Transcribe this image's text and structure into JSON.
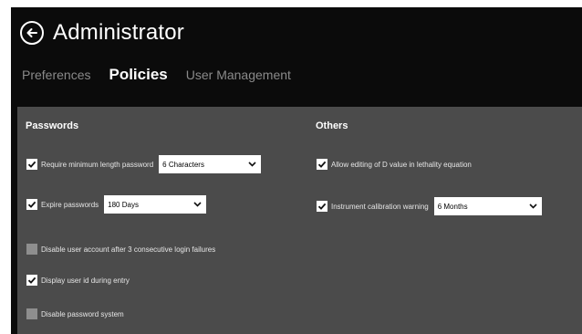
{
  "header": {
    "title": "Administrator",
    "back_icon": "back-arrow-icon"
  },
  "tabs": [
    {
      "label": "Preferences",
      "active": false
    },
    {
      "label": "Policies",
      "active": true
    },
    {
      "label": "User Management",
      "active": false
    }
  ],
  "passwords": {
    "heading": "Passwords",
    "min_length": {
      "checked": true,
      "label": "Require minimum length password",
      "value": "6 Characters"
    },
    "expire": {
      "checked": true,
      "label": "Expire passwords",
      "value": "180 Days"
    },
    "disable_account": {
      "checked": false,
      "label": "Disable user account after 3 consecutive login failures"
    },
    "display_user_id": {
      "checked": true,
      "label": "Display user id during entry"
    },
    "disable_system": {
      "checked": false,
      "label": "Disable password system"
    }
  },
  "others": {
    "heading": "Others",
    "allow_d_value": {
      "checked": true,
      "label": "Allow editing of D value in lethality equation"
    },
    "calibration": {
      "checked": true,
      "label": "Instrument calibration warning",
      "value": "6 Months"
    }
  },
  "colors": {
    "background": "#0b0b0b",
    "panel": "#4b4b4b",
    "tab_inactive": "#8a8a8a",
    "text": "#ffffff"
  }
}
